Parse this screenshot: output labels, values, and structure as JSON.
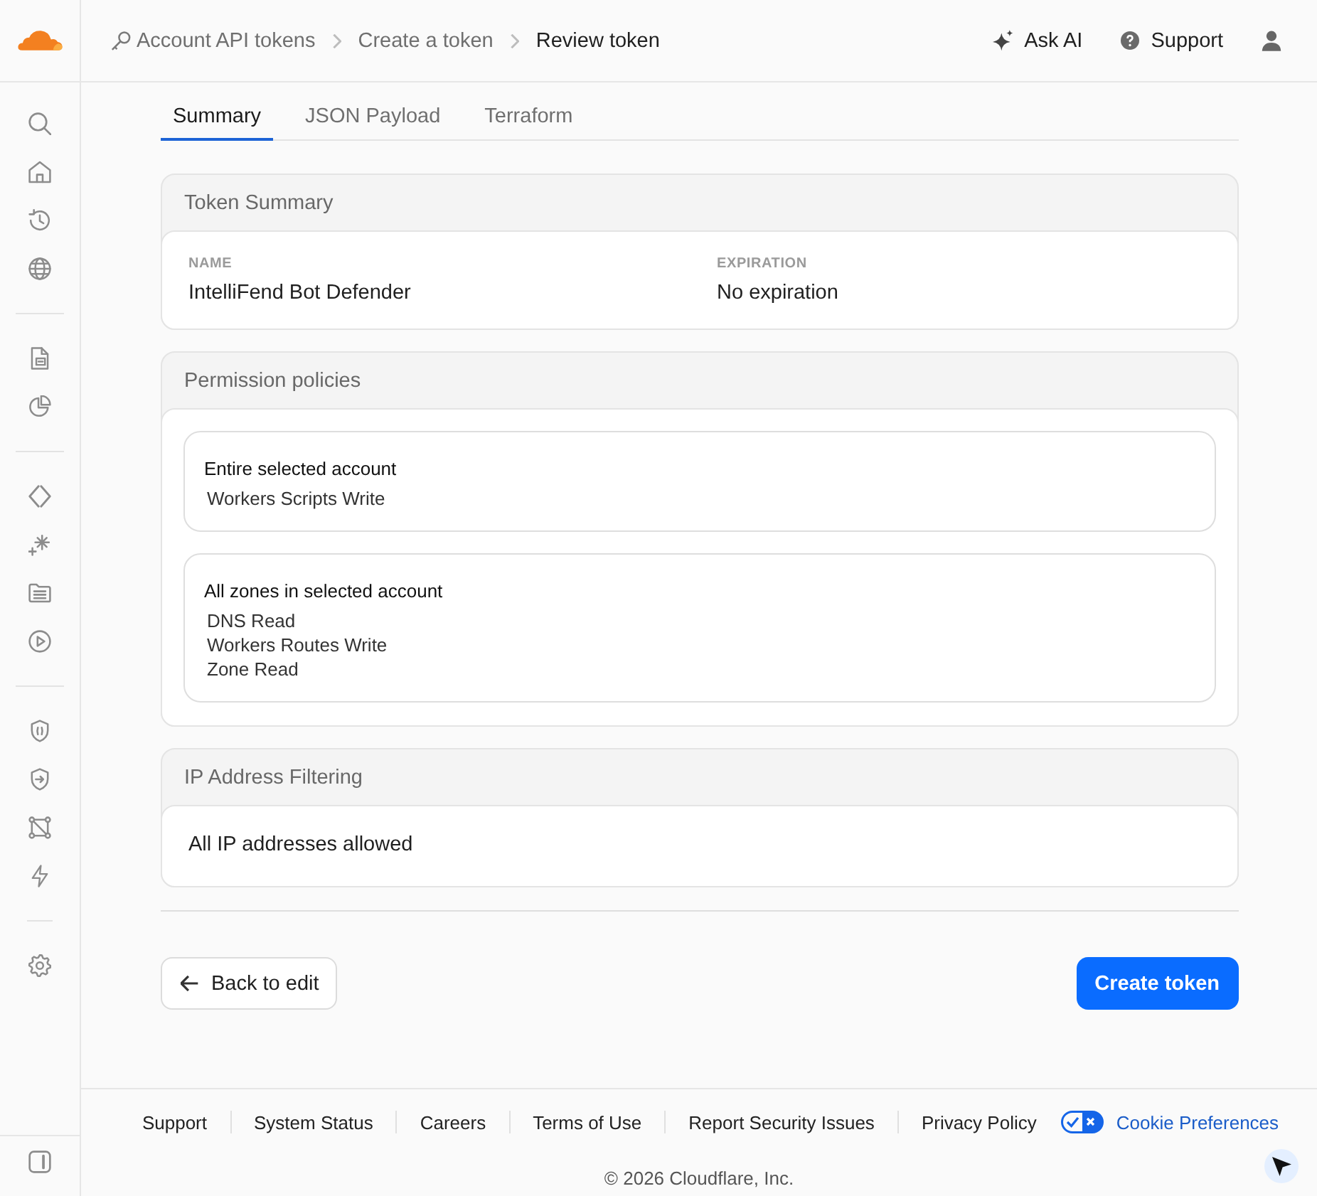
{
  "header": {
    "breadcrumbs": [
      {
        "label": "Account API tokens",
        "current": false
      },
      {
        "label": "Create a token",
        "current": false
      },
      {
        "label": "Review token",
        "current": true
      }
    ],
    "actions": [
      "Ask AI",
      "Support"
    ]
  },
  "tabs": [
    {
      "label": "Summary",
      "selected": true
    },
    {
      "label": "JSON Payload",
      "selected": false
    },
    {
      "label": "Terraform",
      "selected": false
    }
  ],
  "token_summary": {
    "title": "Token Summary",
    "fields": [
      {
        "label": "NAME",
        "value": "IntelliFend Bot Defender"
      },
      {
        "label": "EXPIRATION",
        "value": "No expiration"
      }
    ]
  },
  "permission_policies": {
    "title": "Permission policies",
    "policies": [
      {
        "scope": "Entire selected account",
        "permissions": [
          "Workers Scripts Write"
        ]
      },
      {
        "scope": "All zones in selected account",
        "permissions": [
          "DNS Read",
          "Workers Routes Write",
          "Zone Read"
        ]
      }
    ]
  },
  "ip_address_filtering": {
    "title": "IP Address Filtering",
    "text": "All IP addresses allowed"
  },
  "buttons": [
    {
      "label": "Back to edit",
      "kind": "back"
    },
    {
      "label": "Create token",
      "kind": "primary"
    }
  ],
  "footer": {
    "links": [
      "Support",
      "System Status",
      "Careers",
      "Terms of Use",
      "Report Security Issues",
      "Privacy Policy"
    ],
    "cookie_preferences": "Cookie Preferences",
    "copyright": "© 2026 Cloudflare, Inc."
  }
}
